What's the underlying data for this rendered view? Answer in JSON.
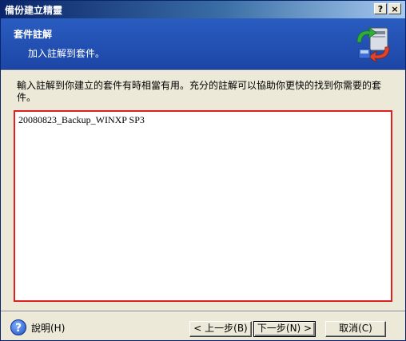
{
  "window": {
    "title": "備份建立精靈",
    "help_button": "?",
    "close_button": "×"
  },
  "header": {
    "title": "套件註解",
    "subtitle": "加入註解到套件。",
    "icon": "backup-wizard-icon"
  },
  "body": {
    "description": "輸入註解到你建立的套件有時相當有用。充分的註解可以協助你更快的找到你需要的套件。",
    "comment_value": "20080823_Backup_WINXP SP3"
  },
  "footer": {
    "help_label": "說明(H)",
    "back_label": "< 上一步(B)",
    "next_label": "下一步(N) >",
    "cancel_label": "取消(C)"
  },
  "colors": {
    "title_bar": "#0a246a",
    "header_bg": "#1c46a6",
    "highlight_border": "#e02020",
    "dialog_bg": "#ece9d8"
  }
}
